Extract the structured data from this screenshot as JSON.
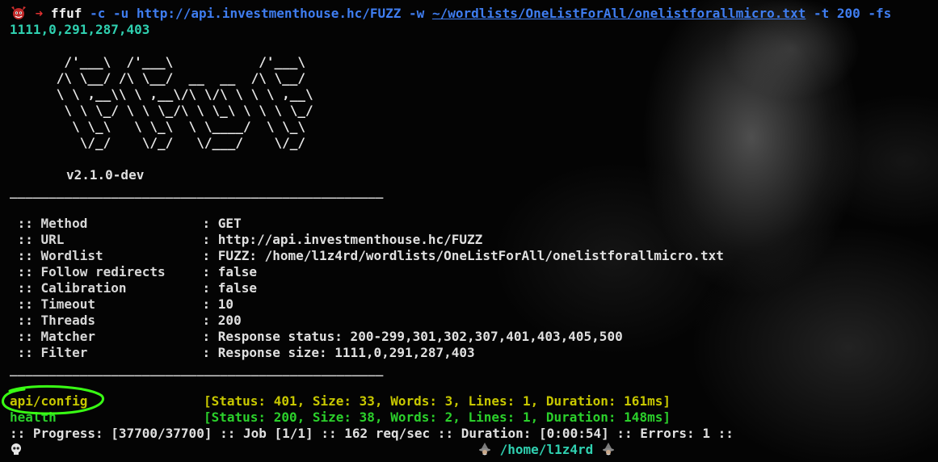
{
  "command": {
    "name": "ffuf",
    "args_pre": "-c -u",
    "url": "http://api.investmenthouse.hc/FUZZ",
    "wflag": "-w",
    "wordlist": "~/wordlists/OneListForAll/onelistforallmicro.txt",
    "tail": "-t 200 -fs",
    "continuation": "1111,0,291,287,403"
  },
  "banner": {
    "ascii": [
      "       /'___\\  /'___\\           /'___\\",
      "      /\\ \\__/ /\\ \\__/  __  __  /\\ \\__/",
      "      \\ \\ ,__\\\\ \\ ,__\\/\\ \\/\\ \\ \\ \\ ,__\\",
      "       \\ \\ \\_/ \\ \\ \\_/\\ \\ \\_\\ \\ \\ \\ \\_/",
      "        \\ \\_\\   \\ \\_\\  \\ \\____/  \\ \\_\\",
      "         \\/_/    \\/_/   \\/___/    \\/_/"
    ],
    "version": "v2.1.0-dev",
    "separator": "________________________________________________"
  },
  "config": [
    {
      "key": "Method",
      "value": "GET"
    },
    {
      "key": "URL",
      "value": "http://api.investmenthouse.hc/FUZZ"
    },
    {
      "key": "Wordlist",
      "value": "FUZZ: /home/l1z4rd/wordlists/OneListForAll/onelistforallmicro.txt"
    },
    {
      "key": "Follow redirects",
      "value": "false"
    },
    {
      "key": "Calibration",
      "value": "false"
    },
    {
      "key": "Timeout",
      "value": "10"
    },
    {
      "key": "Threads",
      "value": "200"
    },
    {
      "key": "Matcher",
      "value": "Response status: 200-299,301,302,307,401,403,405,500"
    },
    {
      "key": "Filter",
      "value": "Response size: 1111,0,291,287,403"
    }
  ],
  "results": [
    {
      "path": "api/config",
      "info": "[Status: 401, Size: 33, Words: 3, Lines: 1, Duration: 161ms]",
      "color": "#c8c800"
    },
    {
      "path": "health",
      "info": "[Status: 200, Size: 38, Words: 2, Lines: 1, Duration: 148ms]",
      "color": "#2bd02b"
    }
  ],
  "progress": ":: Progress: [37700/37700] :: Job [1/1] :: 162 req/sec :: Duration: [0:00:54] :: Errors: 1 ::",
  "prompt": {
    "path": "/home/l1z4rd"
  },
  "colors": {
    "prompt_blue": "#3f7df0",
    "status_401": "#c8c800",
    "status_200": "#2bd02b",
    "highlight_circle": "#39ff14"
  },
  "icons": [
    "devil-icon",
    "skull-icon",
    "wizard-icon"
  ]
}
